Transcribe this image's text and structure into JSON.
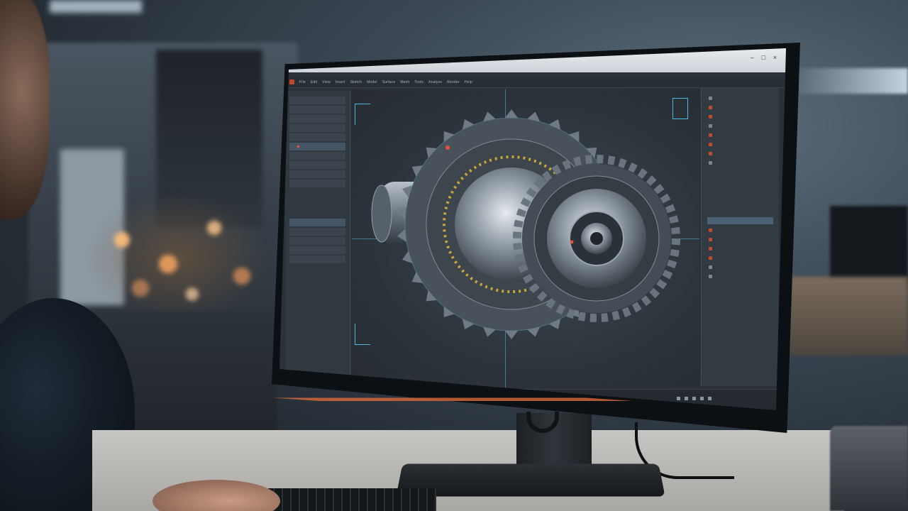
{
  "window": {
    "controls": [
      "–",
      "□",
      "×"
    ]
  },
  "menubar": {
    "items": [
      "File",
      "Edit",
      "View",
      "Insert",
      "Sketch",
      "Model",
      "Surface",
      "Mesh",
      "Tools",
      "Analyze",
      "Render",
      "Help"
    ]
  },
  "left_panel": {
    "rows": [
      "",
      "",
      "",
      "",
      "",
      "",
      "",
      "",
      "",
      "",
      "",
      "",
      "",
      "",
      "",
      "",
      ""
    ]
  },
  "right_panel": {
    "items": [
      "",
      "",
      "",
      "",
      "",
      "",
      "",
      ""
    ],
    "history_rows": [
      "",
      "",
      "",
      "",
      "",
      ""
    ]
  },
  "taskbar": {
    "search_placeholder": "",
    "icons": [
      "app-icon",
      "settings-icon",
      "globe-icon"
    ]
  },
  "colors": {
    "accent_red": "#c14a33",
    "axis_blue": "#4db8e0",
    "viewport_bg": "#2d343c"
  }
}
